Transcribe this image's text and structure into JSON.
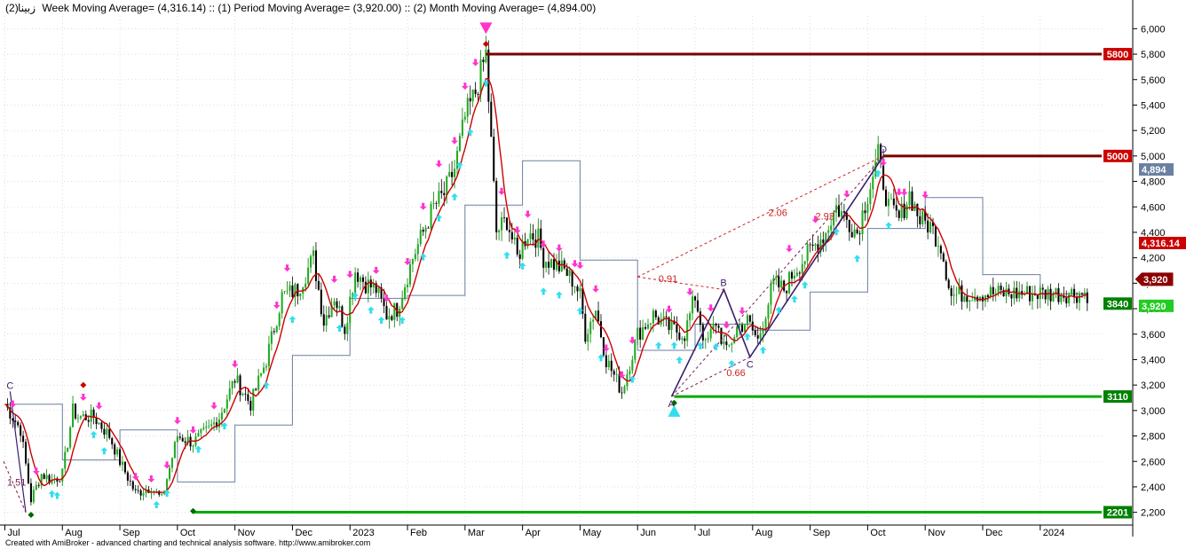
{
  "header": {
    "symbol_name": "زبينا",
    "indicators_text": "(2) Week Moving Average= (4,316.14) :: (1) Period Moving Average= (3,920.00) :: (2) Month Moving Average= (4,894.00)"
  },
  "footer": {
    "credit": "Created with AmiBroker - advanced charting and technical analysis software. http://www.amibroker.com"
  },
  "chart_data": {
    "type": "candlestick",
    "y_axis": {
      "range": [
        2100,
        6100
      ],
      "ticks": [
        2200,
        2400,
        2600,
        2800,
        3000,
        3200,
        3400,
        3600,
        3800,
        4000,
        4200,
        4400,
        4600,
        4800,
        5000,
        5200,
        5400,
        5600,
        5800,
        6000
      ],
      "tick_labels": [
        "2,200",
        "2,400",
        "2,600",
        "2,800",
        "3,000",
        "3,200",
        "3,400",
        "3,600",
        "3,800",
        "4,000",
        "4,200",
        "4,400",
        "4,600",
        "4,800",
        "5,000",
        "5,200",
        "5,400",
        "5,600",
        "5,800",
        "6,000"
      ],
      "position": "right"
    },
    "x_axis": {
      "labels": [
        "Jul",
        "Aug",
        "Sep",
        "Oct",
        "Nov",
        "Dec",
        "2023",
        "Feb",
        "Mar",
        "Apr",
        "May",
        "Jun",
        "Jul",
        "Aug",
        "Sep",
        "Oct",
        "Nov",
        "Dec",
        "2024"
      ],
      "label_positions": [
        0,
        22,
        44,
        66,
        88,
        110,
        132,
        154,
        176,
        198,
        220,
        242,
        264,
        286,
        308,
        330,
        352,
        374,
        396
      ],
      "total_bars": 420
    },
    "grid": true,
    "price_anchors": {
      "x": [
        0,
        6,
        10,
        14,
        18,
        22,
        26,
        28,
        34,
        40,
        44,
        50,
        56,
        60,
        66,
        72,
        78,
        82,
        86,
        88,
        94,
        100,
        106,
        112,
        118,
        122,
        126,
        130,
        134,
        138,
        142,
        146,
        150,
        156,
        160,
        164,
        168,
        172,
        176,
        180,
        184,
        188,
        192,
        196,
        200,
        204,
        206,
        210,
        214,
        216,
        218,
        220,
        222,
        226,
        230,
        236,
        242,
        248,
        254,
        260,
        264,
        268,
        272,
        276,
        280,
        284,
        288,
        294,
        298,
        302,
        306,
        310,
        314,
        318,
        322,
        326,
        330,
        334,
        338,
        342,
        346,
        350,
        354,
        358,
        362,
        366,
        370,
        374,
        378,
        382,
        386,
        390,
        394,
        396,
        400,
        402,
        404,
        406,
        408,
        410,
        412,
        414
      ],
      "y": [
        3050,
        2850,
        2300,
        2500,
        2450,
        2500,
        3000,
        2950,
        2950,
        2800,
        2600,
        2350,
        2400,
        2300,
        2800,
        2750,
        2850,
        2950,
        3150,
        3250,
        3050,
        3400,
        3900,
        3950,
        4200,
        3700,
        3900,
        3650,
        4100,
        4000,
        3950,
        3750,
        3800,
        4200,
        4400,
        4600,
        4700,
        4900,
        5300,
        5500,
        5800,
        4400,
        4500,
        4200,
        4400,
        4350,
        4200,
        4150,
        4100,
        4050,
        4000,
        3900,
        3600,
        3800,
        3400,
        3150,
        3600,
        3750,
        3650,
        3600,
        3900,
        3500,
        3700,
        3450,
        3650,
        3700,
        3550,
        4000,
        3950,
        4100,
        4200,
        4300,
        4400,
        4600,
        4500,
        4400,
        4700,
        5000,
        4600,
        4500,
        4700,
        4500,
        4450,
        4300,
        3900,
        3920,
        3920,
        3920,
        3920,
        3920,
        3920,
        3920,
        3920,
        3920,
        3920,
        3920,
        3920,
        3920,
        3920,
        3920,
        3920,
        3920
      ]
    },
    "series": [
      {
        "name": "(2) Week Moving Average",
        "value": 4316.14,
        "label": "4,316.14",
        "color": "#cc0000"
      },
      {
        "name": "(1) Period Moving Average",
        "value": 3920.0,
        "label": "3,920",
        "color": "#000000"
      },
      {
        "name": "(2) Month Moving Average",
        "value": 4894.0,
        "label": "4,894",
        "color": "#6b7fa0"
      }
    ],
    "last_price": {
      "value": 3920,
      "label": "3,920",
      "color": "#8b0000",
      "outline_color": "#ffffff"
    },
    "horizontal_levels": [
      {
        "value": 5800,
        "label": "5800",
        "color": "#7a0000",
        "badge_color": "#cc0000"
      },
      {
        "value": 5000,
        "label": "5000",
        "color": "#7a0000",
        "badge_color": "#cc0000"
      },
      {
        "value": 3840,
        "label": "3840",
        "color": "#008000",
        "badge_color": "#008000"
      },
      {
        "value": 3110,
        "label": "3110",
        "color": "#00aa00",
        "badge_color": "#008000"
      },
      {
        "value": 2201,
        "label": "2201",
        "color": "#00aa00",
        "badge_color": "#008000"
      }
    ],
    "price_tags": [
      {
        "value": 4894,
        "label": "4,894",
        "color": "#6b7fa0"
      },
      {
        "value": 4316.14,
        "label": "4,316.14",
        "color": "#cc0000"
      },
      {
        "value": 3920,
        "label": "3,920",
        "color": "#22cc22"
      }
    ],
    "harmonic_pattern": {
      "points": [
        {
          "name": "A",
          "x": 255,
          "y": 3110
        },
        {
          "name": "B",
          "x": 275,
          "y": 3950
        },
        {
          "name": "C",
          "x": 285,
          "y": 3420
        },
        {
          "name": "D",
          "x": 336,
          "y": 5000
        }
      ],
      "ratios": [
        {
          "label": "0.91",
          "x": 250,
          "y": 4010
        },
        {
          "label": "0.66",
          "x": 276,
          "y": 3270
        },
        {
          "label": "2.06",
          "x": 292,
          "y": 4530
        },
        {
          "label": "2.92",
          "x": 310,
          "y": 4500
        }
      ],
      "early_pattern": {
        "points": [
          {
            "name": "C",
            "x": 2,
            "y": 3150
          },
          {
            "name": "",
            "x": 8,
            "y": 2200
          }
        ],
        "ratio_label": "1.51"
      },
      "colors": {
        "solid": "#3a1e6e",
        "dashed": "#7a1c52",
        "red_dashed": "#cc2222",
        "ratio_text": "#cc2222"
      }
    },
    "pivot_markers": {
      "top_triangle": {
        "x": 184,
        "value": 6000,
        "color": "#ff33cc"
      },
      "bottom_triangle": {
        "x": 256,
        "value": 3000,
        "color": "#33ddee"
      },
      "diamonds": [
        {
          "x": 184,
          "value": 5880,
          "color": "#cc0000"
        },
        {
          "x": 30,
          "value": 3200,
          "color": "#cc0000"
        },
        {
          "x": 10,
          "value": 2180,
          "color": "#006600"
        },
        {
          "x": 72,
          "value": 2210,
          "color": "#006600"
        },
        {
          "x": 256,
          "value": 3060,
          "color": "#006600"
        }
      ]
    },
    "arrows": {
      "down_color": "#ff33cc",
      "up_color": "#33ddee",
      "down_x": [
        3,
        12,
        30,
        36,
        50,
        56,
        62,
        66,
        72,
        80,
        88,
        104,
        108,
        126,
        132,
        142,
        146,
        154,
        160,
        166,
        172,
        176,
        180,
        190,
        196,
        200,
        206,
        212,
        218,
        220,
        226,
        230,
        236,
        240,
        254,
        262,
        270,
        276,
        282,
        300,
        310,
        322,
        336,
        342,
        344,
        352
      ],
      "up_x": [
        18,
        20,
        34,
        38,
        58,
        62,
        74,
        84,
        100,
        110,
        128,
        134,
        140,
        144,
        152,
        160,
        166,
        172,
        174,
        178,
        184,
        192,
        198,
        206,
        212,
        220,
        228,
        240,
        250,
        256,
        258,
        266,
        272,
        278,
        284,
        290,
        296,
        302,
        306,
        318,
        326,
        334,
        338
      ]
    },
    "step_band_note": "Month moving average drawn as step line"
  }
}
